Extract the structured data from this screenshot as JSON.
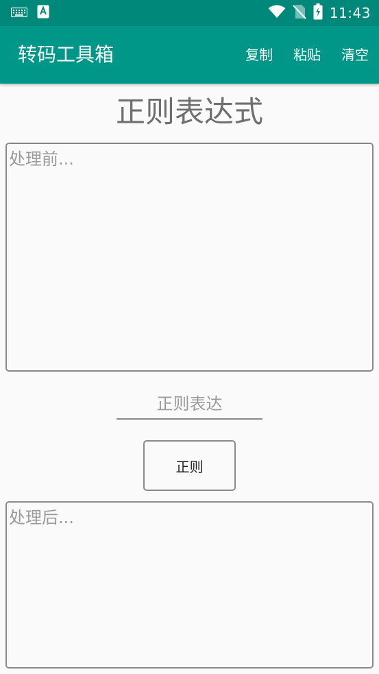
{
  "status_bar": {
    "time": "11:43",
    "left_icons": [
      "keyboard-icon",
      "app-a-icon"
    ],
    "right_icons": [
      "wifi-icon",
      "no-sim-icon",
      "battery-charging-icon"
    ]
  },
  "app_bar": {
    "title": "转码工具箱",
    "background_color": "#009688",
    "status_bar_color": "#00897B",
    "actions": [
      {
        "label": "复制"
      },
      {
        "label": "粘贴"
      },
      {
        "label": "清空"
      }
    ]
  },
  "main": {
    "page_title": "正则表达式",
    "input_before": {
      "value": "",
      "placeholder": "处理前..."
    },
    "regex_field": {
      "value": "",
      "placeholder": "正则表达"
    },
    "regex_button": {
      "label": "正则"
    },
    "output_after": {
      "value": "",
      "placeholder": "处理后..."
    }
  }
}
